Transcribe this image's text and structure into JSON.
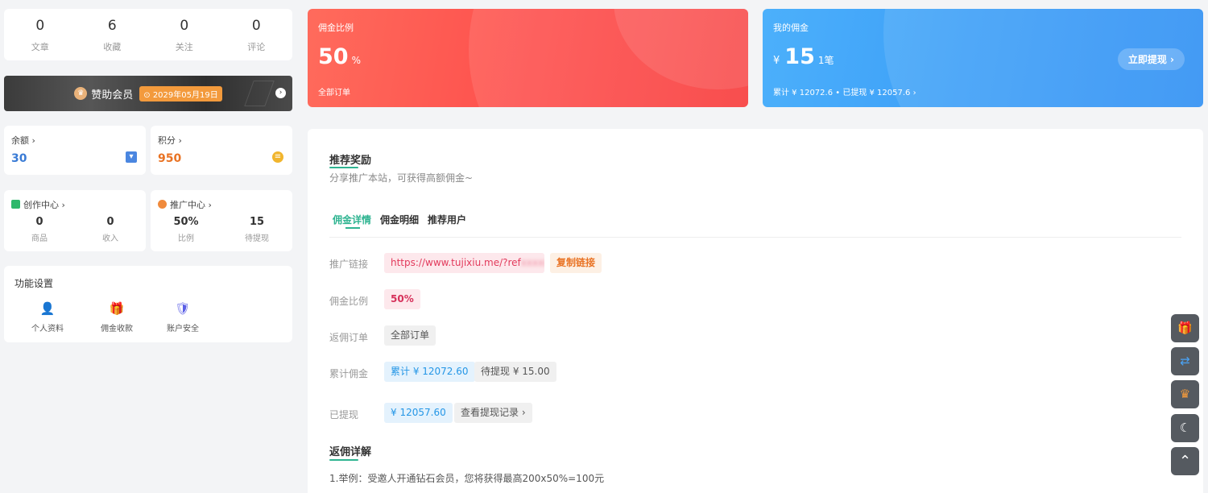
{
  "stats": [
    {
      "value": "0",
      "label": "文章"
    },
    {
      "value": "6",
      "label": "收藏"
    },
    {
      "value": "0",
      "label": "关注"
    },
    {
      "value": "0",
      "label": "评论"
    }
  ],
  "vip": {
    "title": "赞助会员",
    "date": "⊙ 2029年05月19日",
    "arrow": "›"
  },
  "balance": {
    "label": "余额 ›",
    "value": "30",
    "icon": "wallet-icon",
    "color": "#3a7bd5"
  },
  "points": {
    "label": "积分 ›",
    "value": "950",
    "icon": "coins-icon",
    "color": "#e97324"
  },
  "creator": {
    "title": "创作中心 ›",
    "items": [
      {
        "value": "0",
        "label": "商品"
      },
      {
        "value": "0",
        "label": "收入"
      }
    ]
  },
  "promo": {
    "title": "推广中心 ›",
    "items": [
      {
        "value": "50%",
        "label": "比例"
      },
      {
        "value": "15",
        "label": "待提现"
      }
    ]
  },
  "functions": {
    "title": "功能设置",
    "items": [
      {
        "label": "个人资料",
        "icon": "user-profile-icon"
      },
      {
        "label": "佣金收款",
        "icon": "gift-icon"
      },
      {
        "label": "账户安全",
        "icon": "shield-icon"
      }
    ]
  },
  "rate_banner": {
    "title": "佣金比例",
    "value": "50",
    "unit": "%",
    "sub": "全部订单"
  },
  "commission_banner": {
    "title": "我的佣金",
    "currency": "¥",
    "value": "15",
    "count": "1笔",
    "sub": "累计 ¥ 12072.6 • 已提现 ¥ 12057.6 ›",
    "button": "立即提现 ›"
  },
  "main": {
    "section_title": "推荐奖励",
    "section_desc": "分享推广本站，可获得高额佣金~",
    "tabs": [
      "佣金详情",
      "佣金明细",
      "推荐用户"
    ],
    "rows": {
      "link_label": "推广链接",
      "link_value": "https://www.tujixiu.me/?ref",
      "link_masked": "xxxxxxxx",
      "copy_button": "复制链接",
      "rate_label": "佣金比例",
      "rate_value": "50%",
      "orders_label": "返佣订单",
      "orders_value": "全部订单",
      "total_label": "累计佣金",
      "total_value": "累计 ¥ 12072.60",
      "pending_value": "待提现 ¥ 15.00",
      "withdrawn_label": "已提现",
      "withdrawn_value": "¥ 12057.60",
      "records_button": "查看提现记录 ›"
    },
    "detail_title": "返佣详解",
    "example": "1.举例：受邀人开通钻石会员，您将获得最高200x50%=100元"
  },
  "tools": [
    {
      "icon": "gift-icon",
      "glyph": "🎁"
    },
    {
      "icon": "shuffle-icon",
      "glyph": "⇄"
    },
    {
      "icon": "crown-icon",
      "glyph": "♛"
    },
    {
      "icon": "moon-icon",
      "glyph": "☾"
    },
    {
      "icon": "chevron-up-icon",
      "glyph": "⌃"
    }
  ],
  "colors": {
    "accent": "#2fb491",
    "red": "#fd4d4b",
    "blue": "#3a9cf7"
  }
}
